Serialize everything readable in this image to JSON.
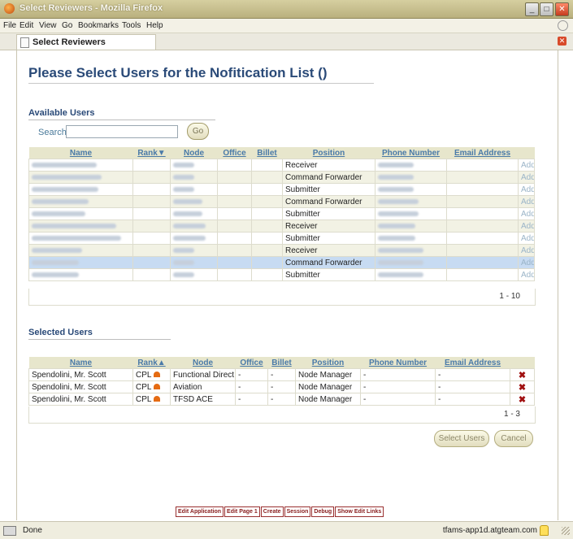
{
  "window": {
    "title": "Select Reviewers - Mozilla Firefox"
  },
  "menu": [
    "File",
    "Edit",
    "View",
    "Go",
    "Bookmarks",
    "Tools",
    "Help"
  ],
  "tab": {
    "label": "Select Reviewers"
  },
  "page": {
    "title": "Please Select Users for the Nofitication List ()"
  },
  "available": {
    "section_title": "Available Users",
    "search_label": "Search",
    "search_value": "",
    "go_label": "Go",
    "columns": [
      "Name",
      "Rank▼",
      "Node",
      "Office",
      "Billet",
      "Position",
      "Phone Number",
      "Email Address",
      ""
    ],
    "rows": [
      {
        "position": "Receiver",
        "action": "Add"
      },
      {
        "position": "Command Forwarder",
        "action": "Add"
      },
      {
        "position": "Submitter",
        "action": "Add"
      },
      {
        "position": "Command Forwarder",
        "action": "Add"
      },
      {
        "position": "Submitter",
        "action": "Add"
      },
      {
        "position": "Receiver",
        "action": "Add"
      },
      {
        "position": "Submitter",
        "action": "Add"
      },
      {
        "position": "Receiver",
        "action": "Add"
      },
      {
        "position": "Command Forwarder",
        "action": "Add"
      },
      {
        "position": "Submitter",
        "action": "Add"
      }
    ],
    "pager": "1 - 10"
  },
  "selected": {
    "section_title": "Selected Users",
    "columns": [
      "Name",
      "Rank▲",
      "Node",
      "Office",
      "Billet",
      "Position",
      "Phone Number",
      "Email Address",
      ""
    ],
    "rows": [
      {
        "name": "Spendolini, Mr. Scott",
        "rank": "CPL",
        "node": "Functional Direct",
        "office": "-",
        "billet": "-",
        "position": "Node Manager",
        "phone": "-",
        "email": "-"
      },
      {
        "name": "Spendolini, Mr. Scott",
        "rank": "CPL",
        "node": "Aviation",
        "office": "-",
        "billet": "-",
        "position": "Node Manager",
        "phone": "-",
        "email": "-"
      },
      {
        "name": "Spendolini, Mr. Scott",
        "rank": "CPL",
        "node": "TFSD ACE",
        "office": "-",
        "billet": "-",
        "position": "Node Manager",
        "phone": "-",
        "email": "-"
      }
    ],
    "pager": "1 - 3"
  },
  "buttons": {
    "select_users": "Select Users",
    "cancel": "Cancel"
  },
  "dev_links": [
    "Edit Application",
    "Edit Page 1",
    "Create",
    "Session",
    "Debug",
    "Show Edit Links"
  ],
  "status": {
    "text": "Done",
    "host": "tfams-app1d.atgteam.com"
  }
}
